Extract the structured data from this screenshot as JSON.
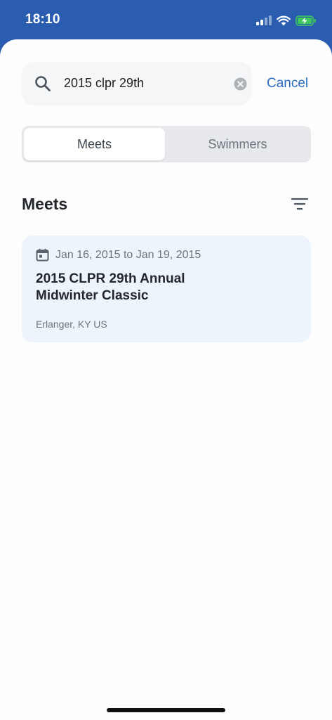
{
  "status": {
    "time": "18:10",
    "icons": [
      "signal-icon",
      "wifi-icon",
      "battery-charging-icon"
    ]
  },
  "search": {
    "query": "2015 clpr 29th",
    "cancel_label": "Cancel"
  },
  "tabs": [
    {
      "label": "Meets",
      "selected": true
    },
    {
      "label": "Swimmers",
      "selected": false
    }
  ],
  "section": {
    "title": "Meets"
  },
  "results": [
    {
      "dates": "Jan 16, 2015 to Jan 19, 2015",
      "title": "2015 CLPR 29th Annual Midwinter Classic",
      "location": "Erlanger, KY US"
    }
  ],
  "colors": {
    "brand": "#2a5db0",
    "accent_link": "#2a6ebf",
    "card_bg": "#edf4fc",
    "battery_green": "#3cc95a"
  }
}
